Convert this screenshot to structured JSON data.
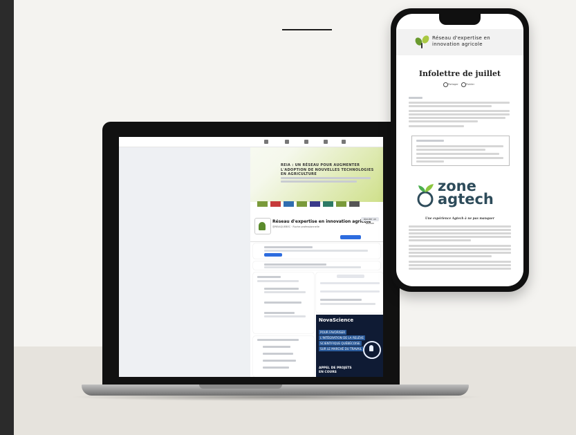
{
  "laptop_screen": {
    "cover_title": "REIA : UN RÉSEAU POUR AUGMENTER L'ADOPTION DE NOUVELLES TECHNOLOGIES EN AGRICULTURE",
    "page_name": "Réseau d'expertise en innovation agricole",
    "page_subtitle": "@REIAQUEBEC · Ruche professionnelle",
    "follow_label": "Ajouter un bouton",
    "ad": {
      "brand": "NovaScience",
      "lines": [
        "POUR FAVORISER",
        "L'INTÉGRATION DE LA RELÈVE",
        "SCIENTIFIQUE QUÉBÉCOISE",
        "SUR LE MARCHÉ DU TRAVAIL"
      ],
      "call": "APPEL DE PROJETS EN COURS"
    }
  },
  "phone_screen": {
    "brand_line1": "Réseau d'expertise en",
    "brand_line2": "innovation agricole",
    "newsletter_title": "Infolettre de juillet",
    "share_left": "Partager",
    "share_right": "Publier",
    "zone_logo_line1": "zone",
    "zone_logo_line2": "agtech",
    "zone_tagline": "Une expérience Agtech à ne pas manquer"
  },
  "colors": {
    "leaf_green": "#6a9a2f",
    "ad_navy": "#0f1b34",
    "fb_blue": "#2d6cdf",
    "zone_text": "#2d4b5a"
  }
}
